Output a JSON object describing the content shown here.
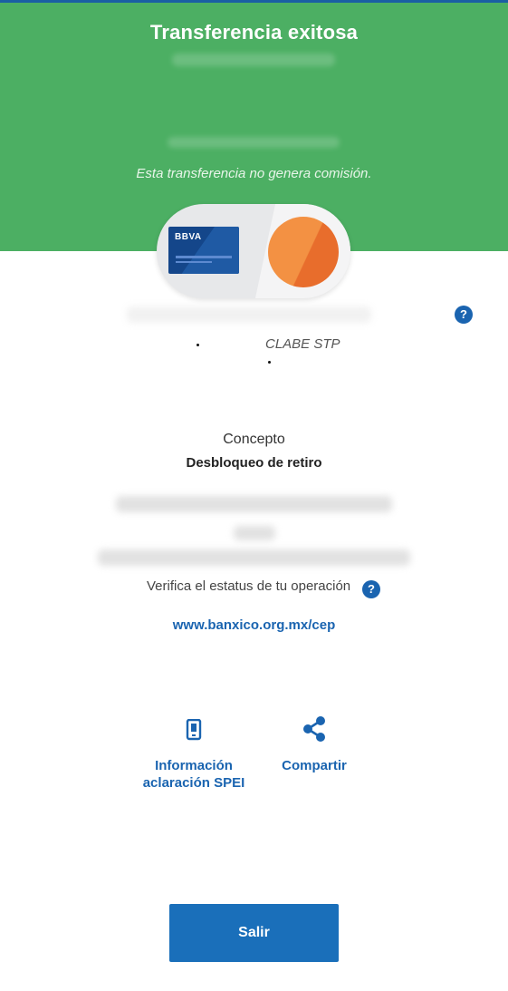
{
  "header": {
    "title": "Transferencia exitosa",
    "subtitle": "Esta transferencia no genera comisión."
  },
  "cards": {
    "origin_bank_logo": "BBVA"
  },
  "destination": {
    "account_type": "CLABE STP"
  },
  "concept": {
    "label": "Concepto",
    "value": "Desbloqueo de retiro"
  },
  "verify": {
    "text": "Verifica el estatus de tu operación",
    "help_icon": "?",
    "link": "www.banxico.org.mx/cep"
  },
  "actions": [
    {
      "label": "Información aclaración SPEI",
      "icon": "phone-icon"
    },
    {
      "label": "Compartir",
      "icon": "share-icon"
    }
  ],
  "footer": {
    "exit_label": "Salir"
  },
  "colors": {
    "header_green": "#4caf63",
    "accent_blue": "#1a64b0",
    "button_blue": "#1a6fba"
  }
}
